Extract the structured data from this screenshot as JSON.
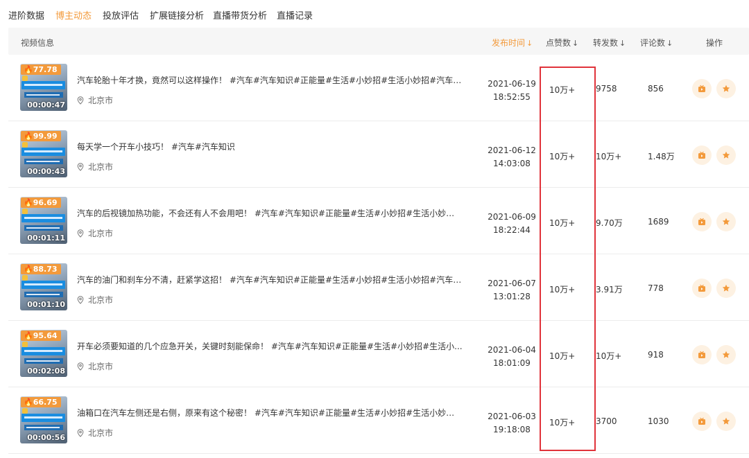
{
  "tabs": [
    {
      "label": "进阶数据",
      "active": false
    },
    {
      "label": "博主动态",
      "active": true
    },
    {
      "label": "投放评估",
      "active": false
    },
    {
      "label": "扩展链接分析",
      "active": false
    },
    {
      "label": "直播带货分析",
      "active": false
    },
    {
      "label": "直播记录",
      "active": false
    }
  ],
  "table": {
    "headers": {
      "video_info": "视频信息",
      "publish_time": "发布时间",
      "likes": "点赞数",
      "shares": "转发数",
      "comments": "评论数",
      "actions": "操作"
    },
    "sort_arrow": "↓",
    "rows": [
      {
        "score": "77.78",
        "duration": "00:00:47",
        "title": "汽车轮胎十年才换，竟然可以这样操作！ #汽车#汽车知识#正能量#生活#小妙招#生活小妙招#汽车故...",
        "location": "北京市",
        "date": "2021-06-19",
        "time": "18:52:55",
        "likes": "10万+",
        "shares": "9758",
        "comments": "856"
      },
      {
        "score": "99.99",
        "duration": "00:00:43",
        "title": "每天学一个开车小技巧！ #汽车#汽车知识",
        "location": "北京市",
        "date": "2021-06-12",
        "time": "14:03:08",
        "likes": "10万+",
        "shares": "10万+",
        "comments": "1.48万"
      },
      {
        "score": "96.69",
        "duration": "00:01:11",
        "title": "汽车的后视镜加热功能，不会还有人不会用吧！ #汽车#汽车知识#正能量#生活#小妙招#生活小妙招#...",
        "location": "北京市",
        "date": "2021-06-09",
        "time": "18:22:44",
        "likes": "10万+",
        "shares": "9.70万",
        "comments": "1689"
      },
      {
        "score": "88.73",
        "duration": "00:01:10",
        "title": "汽车的油门和刹车分不清，赶紧学这招！ #汽车#汽车知识#正能量#生活#小妙招#生活小妙招#汽车故障",
        "location": "北京市",
        "date": "2021-06-07",
        "time": "13:01:28",
        "likes": "10万+",
        "shares": "3.91万",
        "comments": "778"
      },
      {
        "score": "95.64",
        "duration": "00:02:08",
        "title": "开车必须要知道的几个应急开关，关键时刻能保命！ #汽车#汽车知识#正能量#生活#小妙招#生活小...",
        "location": "北京市",
        "date": "2021-06-04",
        "time": "18:01:09",
        "likes": "10万+",
        "shares": "10万+",
        "comments": "918"
      },
      {
        "score": "66.75",
        "duration": "00:00:56",
        "title": "油箱口在汽车左侧还是右侧，原来有这个秘密！ #汽车#汽车知识#正能量#生活#小妙招#生活小妙招#...",
        "location": "北京市",
        "date": "2021-06-03",
        "time": "19:18:08",
        "likes": "10万+",
        "shares": "3700",
        "comments": "1030"
      }
    ]
  },
  "colors": {
    "accent": "#f39a3b",
    "highlight_box": "#e0323a",
    "header_bg": "#f6f6f6"
  },
  "icons": [
    "fire-icon",
    "location-pin-icon",
    "video-icon",
    "star-icon",
    "sort-down-arrow-icon"
  ]
}
